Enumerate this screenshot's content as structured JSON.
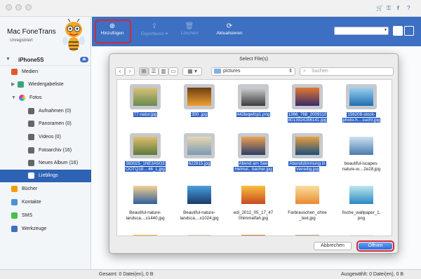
{
  "app": {
    "title": "Mac FoneTrans",
    "subtitle": "Unregistriert"
  },
  "colors": {
    "accent": "#3d6fc2",
    "selection": "#2d62b4",
    "highlight": "#d02a3a"
  },
  "titlebar_icons": [
    "cart-icon",
    "key-icon",
    "facebook-icon",
    "help-icon"
  ],
  "sidebar": {
    "device": "iPhone5S",
    "items": [
      {
        "label": "Medien",
        "icon": "music-icon"
      },
      {
        "label": "Wiedergabeliste",
        "icon": "playlist-icon"
      },
      {
        "label": "Fotos",
        "icon": "photos-icon"
      },
      {
        "label": "Aufnahmen (0)",
        "icon": "camera-icon"
      },
      {
        "label": "Panoramen (0)",
        "icon": "panorama-icon"
      },
      {
        "label": "Videos (0)",
        "icon": "video-icon"
      },
      {
        "label": "Fotoarchiv (16)",
        "icon": "archive-icon"
      },
      {
        "label": "Neues Album (16)",
        "icon": "album-icon"
      },
      {
        "label": "Lieblings",
        "icon": "favorite-icon"
      },
      {
        "label": "Bücher",
        "icon": "book-icon"
      },
      {
        "label": "Kontakte",
        "icon": "contacts-icon"
      },
      {
        "label": "SMS",
        "icon": "sms-icon"
      },
      {
        "label": "Werkzeuge",
        "icon": "tools-icon"
      }
    ]
  },
  "toolbar": {
    "add": "Hinzufügen",
    "export": "Exportieren ▾",
    "delete": "Löschen",
    "refresh": "Aktualisieren"
  },
  "status": {
    "total": "Gesamt: 0 Datei(en), 0 B",
    "selected": "Ausgewählt: 0 Datei(en), 0 B"
  },
  "dialog": {
    "title": "Select File(s)",
    "folder": "pictures",
    "search_placeholder": "Suchen",
    "cancel": "Abbrechen",
    "open": "Öffnen",
    "files": [
      {
        "name": [
          "77-natur.jpg"
        ],
        "selected": true
      },
      {
        "name": [
          "350 .jpg"
        ],
        "selected": true
      },
      {
        "name": [
          "442leqwfcp1.png"
        ],
        "selected": true
      },
      {
        "name": [
          "1366_768_2009110",
          "8013924286141.jpg"
        ],
        "selected": true
      },
      {
        "name": [
          "156208-stock-",
          "photo-h....sucht.jpg"
        ],
        "selected": true
      },
      {
        "name": [
          "383025_1NE3A5O3",
          "OOTQ18....46_L.jpg"
        ],
        "selected": true
      },
      {
        "name": [
          "622915.jpg"
        ],
        "selected": true
      },
      {
        "name": [
          "Abend am See",
          "Helmut...bacher.jpg"
        ],
        "selected": true
      },
      {
        "name": [
          "Abendstimmung in",
          "Venedig.jpg"
        ],
        "selected": true
      },
      {
        "name": [
          "beautiful-iscapes-",
          "nature-w....2e28.jpg"
        ],
        "selected": false
      },
      {
        "name": [
          "Beautiful-nature-",
          "landsca....x1440.jpg"
        ],
        "selected": false
      },
      {
        "name": [
          "Beautiful-nature-",
          "landsca....x1024.jpg"
        ],
        "selected": false
      },
      {
        "name": [
          "edi_2012_05_17_47",
          "0himmelfah.jpg"
        ],
        "selected": false
      },
      {
        "name": [
          "Farbrauschen_ohne",
          "_text.jpg"
        ],
        "selected": false
      },
      {
        "name": [
          "fische_wallpaper_1.",
          "png"
        ],
        "selected": false
      },
      {
        "name": [
          ""
        ],
        "selected": false
      },
      {
        "name": [
          ""
        ],
        "selected": false
      },
      {
        "name": [
          ""
        ],
        "selected": false
      },
      {
        "name": [
          ""
        ],
        "selected": false
      },
      {
        "name": [
          ""
        ],
        "selected": false
      }
    ]
  }
}
